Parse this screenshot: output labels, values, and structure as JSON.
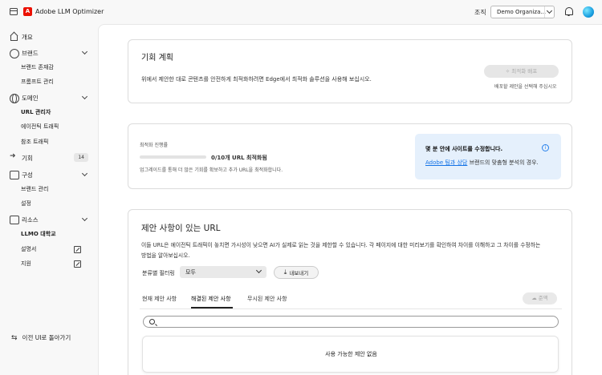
{
  "header": {
    "app_title": "Adobe LLM Optimizer",
    "org_label": "조직",
    "org_value": "Demo Organiza..."
  },
  "sidebar": {
    "items": [
      {
        "label": "개요"
      },
      {
        "label": "브랜드"
      },
      {
        "label": "도메인"
      },
      {
        "label": "기회",
        "badge": "14"
      },
      {
        "label": "구성"
      },
      {
        "label": "리소스"
      }
    ],
    "brand_sub": [
      "브랜드 존재감",
      "프롬프트 관리"
    ],
    "domain_sub": [
      "URL 관리자",
      "에이전틱 트래픽",
      "참조 트래픽"
    ],
    "config_sub": [
      "브랜드 관리",
      "설정"
    ],
    "resources_sub": [
      "LLMO 대학교",
      "설명서",
      "지원"
    ],
    "back_label": "이전 UI로 돌아가기"
  },
  "plan_card": {
    "title": "기회 계획",
    "description": "위에서 제안한 대로 콘텐츠를 안전하게 최적화하려면 Edge에서 최적화 솔루션을 사용해 보십시오.",
    "button_label": "최적화 배포",
    "hint": "배포할 제안을 선택해 주십시오"
  },
  "progress_card": {
    "label": "최적화 진행률",
    "value_text": "0/10개 URL 최적화됨",
    "progress": 0.0,
    "note": "업그레이드를 통해 더 많은 기회를 확보하고 추가 URL을 최적화합니다.",
    "info_title": "몇 분 안에 사이트를 수정합니다.",
    "info_link": "Adobe 팀과 상담",
    "info_rest": " 브랜드의 맞춤형 분석의 경우."
  },
  "urls_card": {
    "title": "제안 사항이 있는 URL",
    "description_line1": "이들 URL은 에이전틱 트래픽이 놓치면 가시성이 낮으면 AI가 실제로 읽는 것을 제한할 수 있습니다. 각 페이지에 대한 미리보기를 확인하여 차이를 이해하고 그 차이를 수정하는",
    "description_line2": "방법을 알아보십시오.",
    "filter_label": "분류별 필터링",
    "filter_value": "모두",
    "export_label": "내보내기",
    "tabs": [
      "현재 제안 사항",
      "해결된 제안 사항",
      "무시된 제안 사항"
    ],
    "action_label": "준액",
    "search_placeholder": "",
    "empty_text": "사용 가능한 제안 없음"
  }
}
